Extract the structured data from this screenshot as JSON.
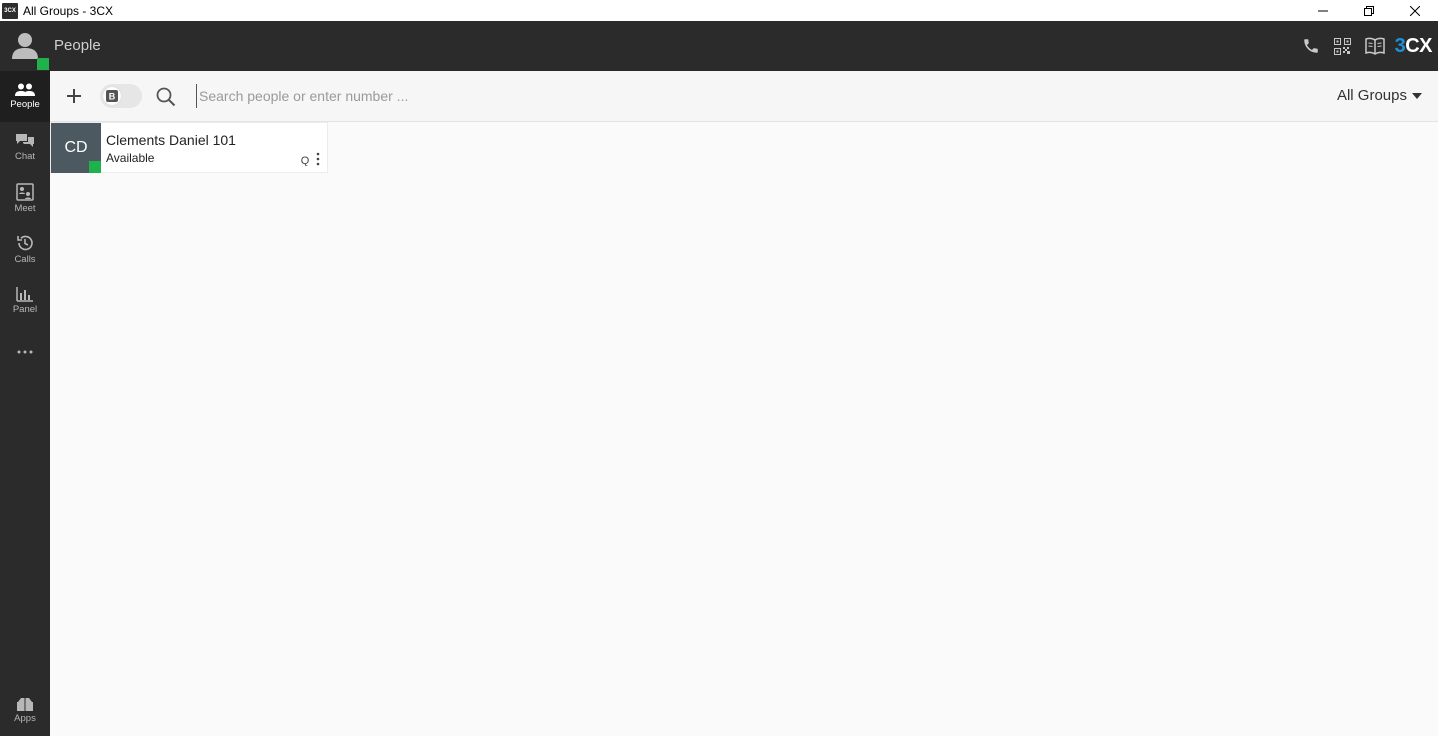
{
  "window": {
    "app_icon_text": "3CX",
    "title": "All Groups - 3CX"
  },
  "header": {
    "page_title": "People",
    "logo_prefix": "3",
    "logo_suffix": "CX"
  },
  "sidebar": {
    "items": [
      {
        "label": "People",
        "icon": "people-icon",
        "active": true
      },
      {
        "label": "Chat",
        "icon": "chat-icon",
        "active": false
      },
      {
        "label": "Meet",
        "icon": "meet-icon",
        "active": false
      },
      {
        "label": "Calls",
        "icon": "history-icon",
        "active": false
      },
      {
        "label": "Panel",
        "icon": "panel-icon",
        "active": false
      }
    ],
    "bottom": {
      "label": "Apps",
      "icon": "apps-icon"
    }
  },
  "toolbar": {
    "toggle_icon_text": "B",
    "search_placeholder": "Search people or enter number ...",
    "groups_label": "All Groups"
  },
  "contacts": [
    {
      "initials": "CD",
      "name": "Clements Daniel 101",
      "status": "Available",
      "queue_icon_text": "Q"
    }
  ],
  "colors": {
    "accent_blue": "#1e90d6",
    "presence_green": "#1fb24a",
    "dark_bg": "#2b2b2b"
  }
}
